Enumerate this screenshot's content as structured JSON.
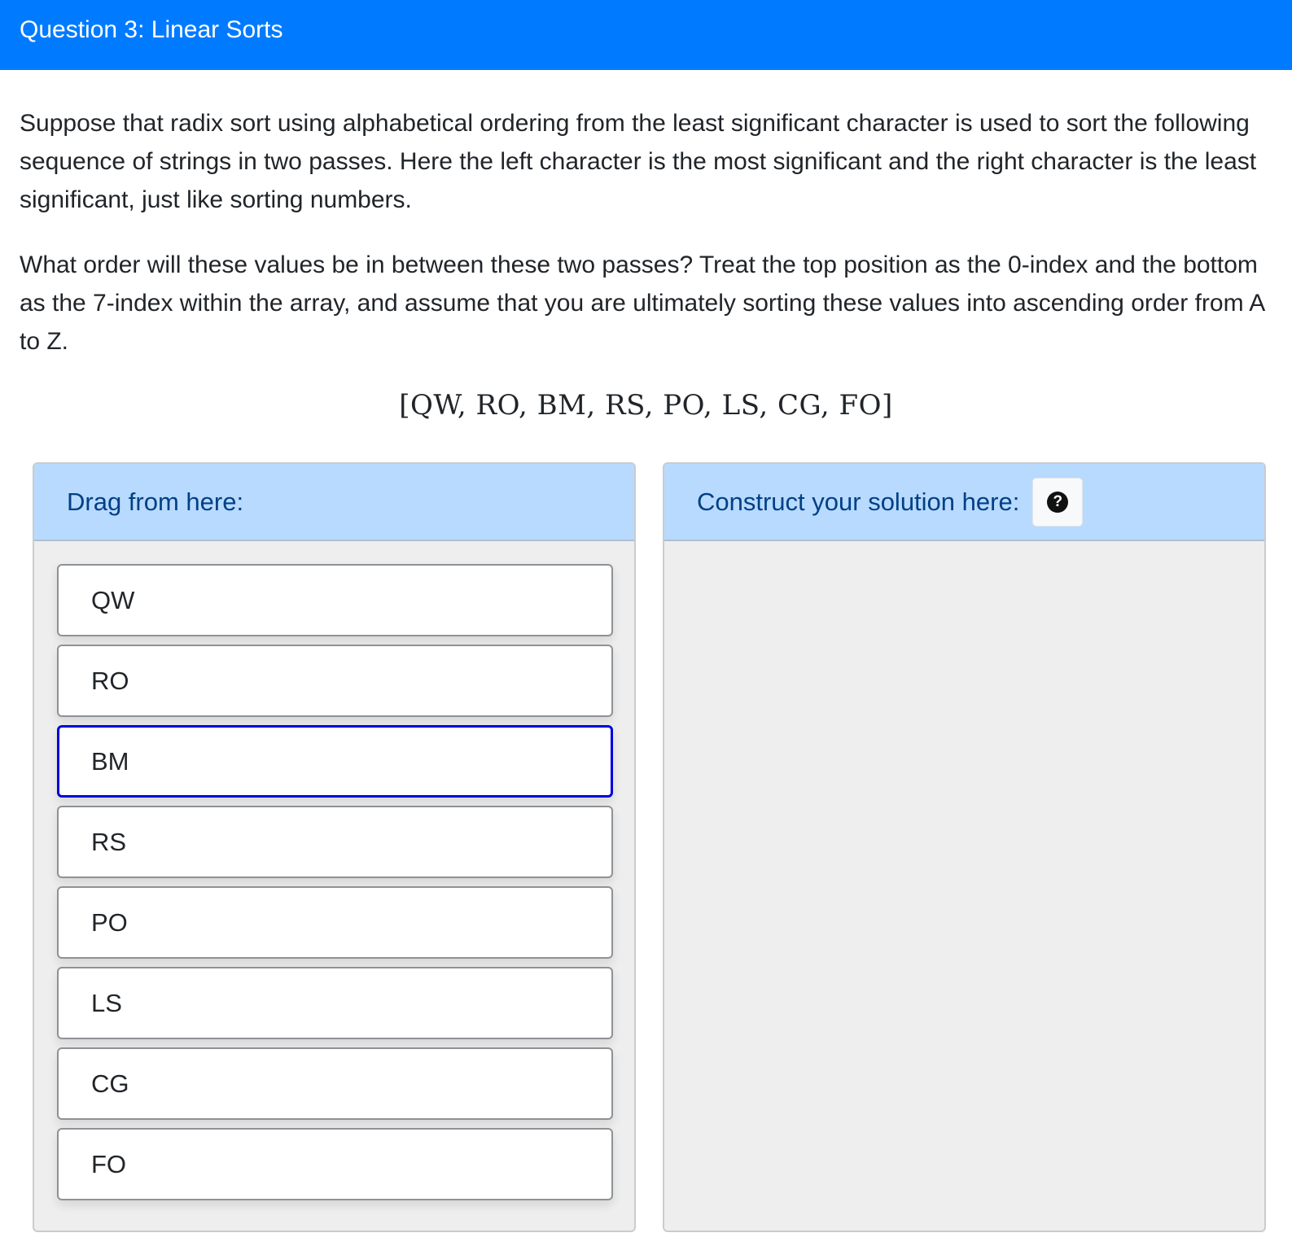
{
  "header": {
    "title": "Question 3: Linear Sorts"
  },
  "question": {
    "paragraph1": "Suppose that radix sort using alphabetical ordering from the least significant character is used to sort the following sequence of strings in two passes. Here the left character is the most significant and the right character is the least significant, just like sorting numbers.",
    "paragraph2": "What order will these values be in between these two passes? Treat the top position as the 0-index and the bottom as the 7-index within the array, and assume that you are ultimately sorting these values into ascending order from A to Z.",
    "sequence": "[QW, RO, BM, RS, PO, LS, CG, FO]"
  },
  "source_panel": {
    "title": "Drag from here:",
    "blocks": [
      {
        "label": "QW"
      },
      {
        "label": "RO"
      },
      {
        "label": "BM"
      },
      {
        "label": "RS"
      },
      {
        "label": "PO"
      },
      {
        "label": "LS"
      },
      {
        "label": "CG"
      },
      {
        "label": "FO"
      }
    ],
    "selected_index": 2
  },
  "answer_panel": {
    "title": "Construct your solution here:",
    "help_icon": "question-circle-icon",
    "help_symbol": "?"
  },
  "colors": {
    "header_bg": "#007bff",
    "panel_header_bg": "#b8daff",
    "panel_header_text": "#004085",
    "panel_body_bg": "#eeeeee",
    "selected_border": "#0000dd"
  }
}
